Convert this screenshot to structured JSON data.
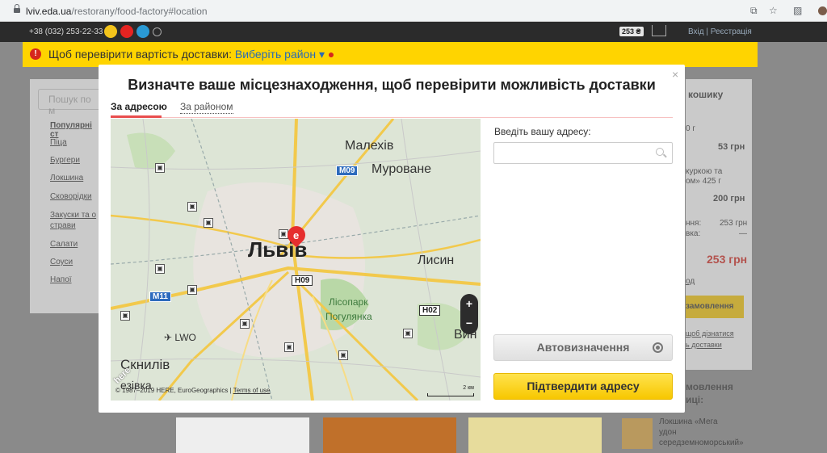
{
  "browser": {
    "url_host": "lviv.eda.ua",
    "url_path": "/restorany/food-factory#location"
  },
  "topbar": {
    "phone": "+38 (032) 253-22-33",
    "cart_total": "253 ₴",
    "auth": "Вхід | Реєстрація"
  },
  "delivery_bar": {
    "text": "Щоб перевірити вартість доставки:",
    "link": "Виберіть район ▾"
  },
  "background": {
    "search_placeholder": "Пошук по м",
    "categories": [
      "Популярні ст",
      "Піца",
      "Бургери",
      "Локшина",
      "Сковорідки",
      "Закуски та о",
      "страви",
      "Салати",
      "Соуси",
      "Напої"
    ],
    "cart_header": "кошику",
    "cart_items": [
      "0 г",
      "53 грн",
      "куркою та",
      "ом» 425 г",
      "200 грн",
      "ння:",
      "253 грн",
      "вка:",
      "—",
      "253 грн",
      "од",
      "замовлення",
      "щоб дізнатися",
      "ь доставки",
      "мовлення",
      "иці:",
      "Локшина «Мега",
      "удон",
      "середземноморський»"
    ]
  },
  "modal": {
    "title": "Визначте ваше місцезнаходження, щоб перевірити можливість доставки",
    "tabs": [
      {
        "label": "За адресою",
        "active": true
      },
      {
        "label": "За районом",
        "active": false
      }
    ],
    "address_label": "Введіть вашу адресу:",
    "address_value": "",
    "auto_button": "Автовизначення",
    "confirm_button": "Підтвердити адресу"
  },
  "map": {
    "labels": [
      "Малехів",
      "Муроване",
      "Львів",
      "Лисин",
      "Лісопарк",
      "Погулянка",
      "Вин",
      "LWO",
      "Скнилів",
      "езівка"
    ],
    "road_shields": [
      "M09",
      "H09",
      "M11",
      "H02"
    ],
    "zoom_in": "+",
    "zoom_out": "−",
    "copyright": "© 1987–2019 HERE, EuroGeographics |",
    "terms": "Terms of use",
    "scale": "2 км",
    "logo": "here"
  }
}
